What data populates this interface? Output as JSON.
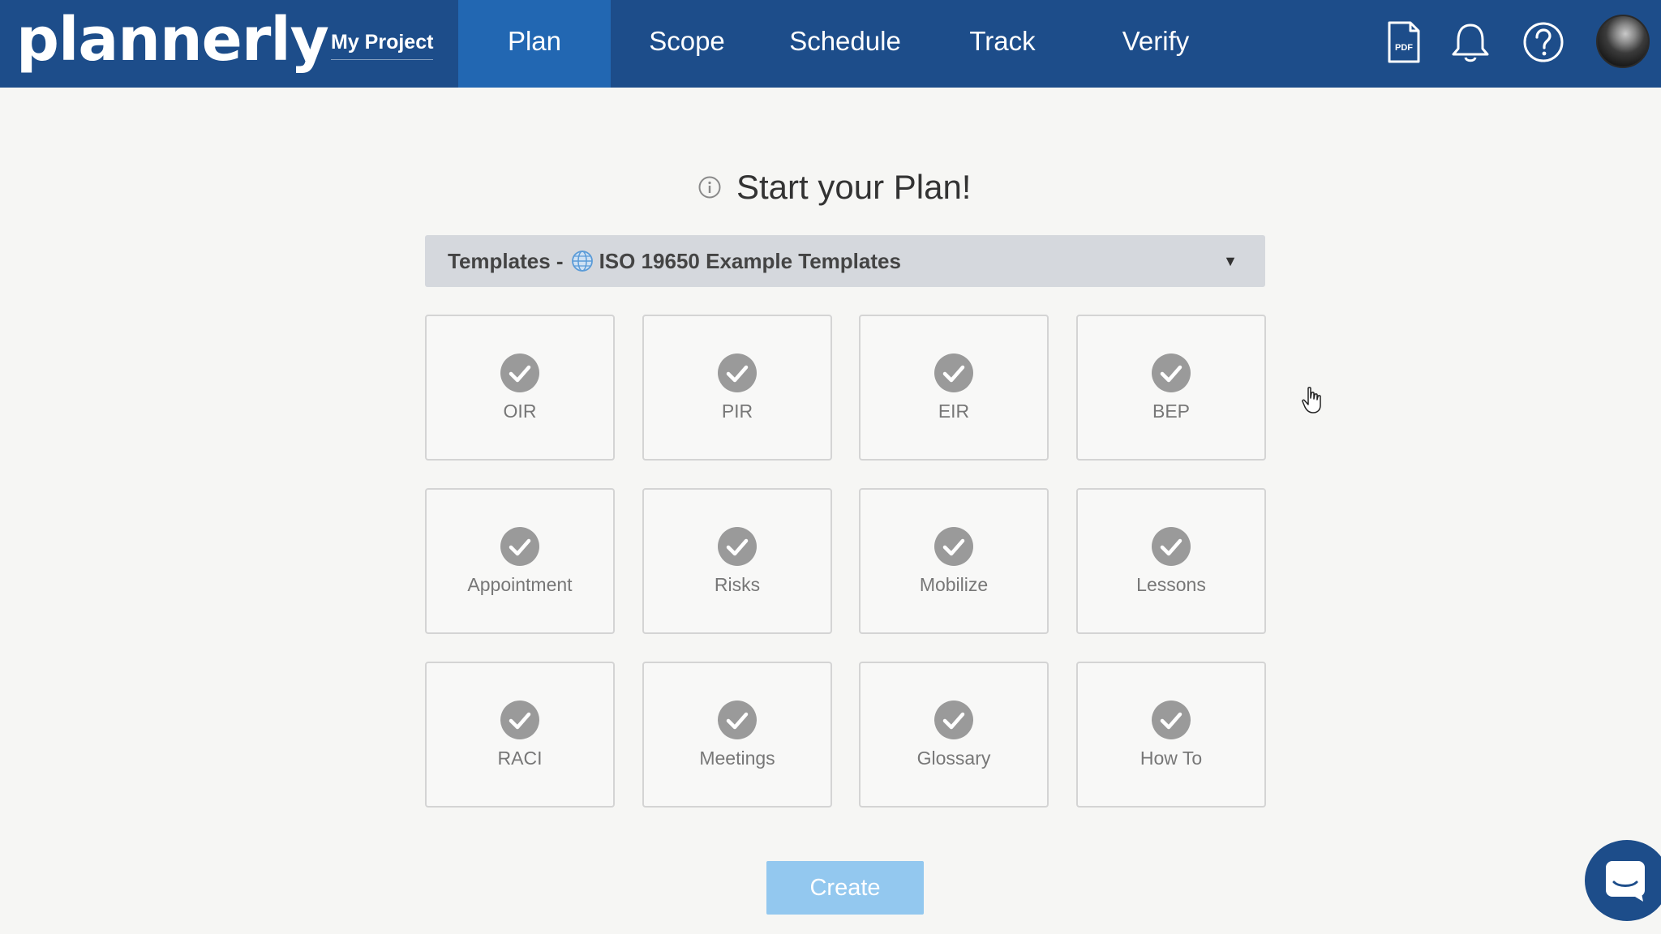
{
  "brand": {
    "logo_text": "plannerly"
  },
  "header": {
    "project_label": "My Project",
    "tabs": [
      {
        "label": "Plan",
        "active": true
      },
      {
        "label": "Scope",
        "active": false
      },
      {
        "label": "Schedule",
        "active": false
      },
      {
        "label": "Track",
        "active": false
      },
      {
        "label": "Verify",
        "active": false
      }
    ],
    "icons": [
      "pdf-icon",
      "bell-icon",
      "help-icon",
      "avatar"
    ]
  },
  "main": {
    "title": "Start your Plan!",
    "template_select": {
      "prefix": "Templates -",
      "value": "ISO 19650 Example Templates"
    },
    "cards": [
      {
        "label": "OIR",
        "checked": true
      },
      {
        "label": "PIR",
        "checked": true
      },
      {
        "label": "EIR",
        "checked": true
      },
      {
        "label": "BEP",
        "checked": true
      },
      {
        "label": "Appointment",
        "checked": true
      },
      {
        "label": "Risks",
        "checked": true
      },
      {
        "label": "Mobilize",
        "checked": true
      },
      {
        "label": "Lessons",
        "checked": true
      },
      {
        "label": "RACI",
        "checked": true
      },
      {
        "label": "Meetings",
        "checked": true
      },
      {
        "label": "Glossary",
        "checked": true
      },
      {
        "label": "How To",
        "checked": true
      }
    ],
    "create_label": "Create"
  },
  "colors": {
    "header_bg": "#1d4d8a",
    "active_tab_bg": "#2267b2",
    "page_bg": "#f6f6f4",
    "check_gray": "#9a9a9a",
    "create_button_bg": "#93c8ef"
  }
}
